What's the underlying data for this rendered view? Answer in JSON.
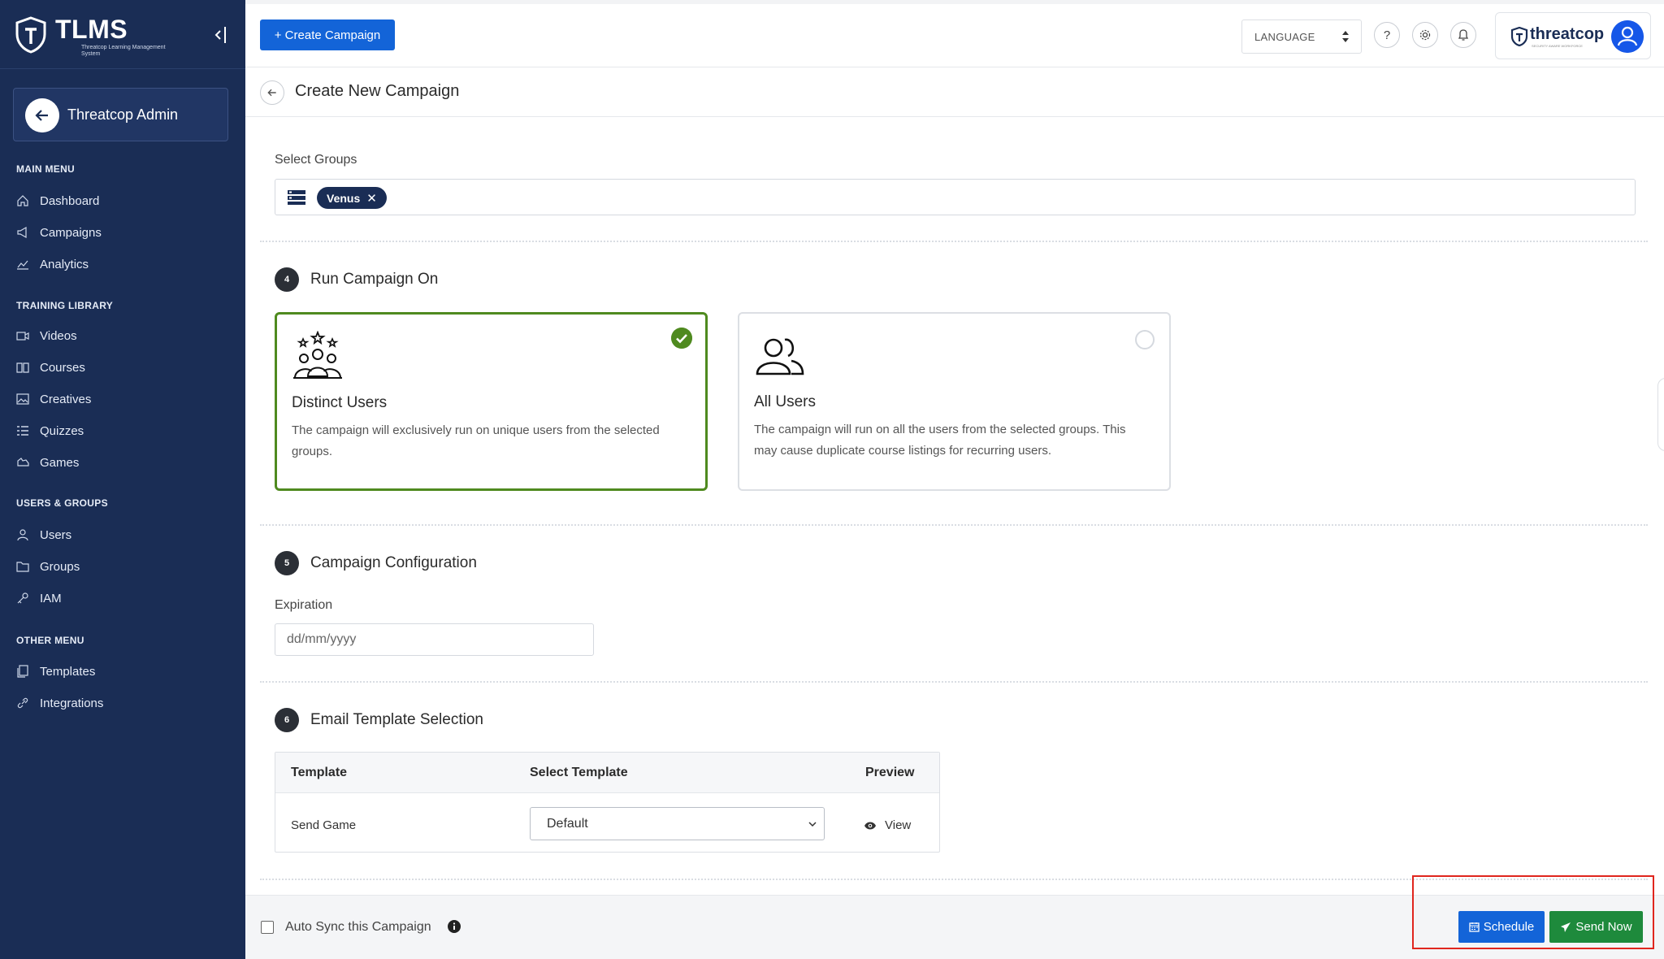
{
  "brand": {
    "name": "TLMS",
    "subtitle": "Threatcop Learning Management System"
  },
  "admin": {
    "name": "Threatcop Admin"
  },
  "sidebar": {
    "sections": [
      {
        "title": "MAIN MENU",
        "items": [
          {
            "label": "Dashboard",
            "icon": "home-icon"
          },
          {
            "label": "Campaigns",
            "icon": "megaphone-icon"
          },
          {
            "label": "Analytics",
            "icon": "chart-line-icon"
          }
        ]
      },
      {
        "title": "TRAINING LIBRARY",
        "items": [
          {
            "label": "Videos",
            "icon": "video-icon"
          },
          {
            "label": "Courses",
            "icon": "book-icon"
          },
          {
            "label": "Creatives",
            "icon": "image-icon"
          },
          {
            "label": "Quizzes",
            "icon": "list-icon"
          },
          {
            "label": "Games",
            "icon": "gamepad-icon"
          }
        ]
      },
      {
        "title": "USERS & GROUPS",
        "items": [
          {
            "label": "Users",
            "icon": "user-icon"
          },
          {
            "label": "Groups",
            "icon": "folder-icon"
          },
          {
            "label": "IAM",
            "icon": "key-icon"
          }
        ]
      },
      {
        "title": "OTHER MENU",
        "items": [
          {
            "label": "Templates",
            "icon": "copy-icon"
          },
          {
            "label": "Integrations",
            "icon": "link-icon"
          }
        ]
      }
    ]
  },
  "topbar": {
    "create_label": "+ Create Campaign",
    "language_label": "LANGUAGE",
    "help_label": "?",
    "company_name": "threatcop",
    "company_tagline": "SECURITY AWARE WORKFORCE"
  },
  "page": {
    "title": "Create New Campaign"
  },
  "groups": {
    "label": "Select Groups",
    "selected": [
      "Venus"
    ]
  },
  "run_campaign": {
    "step": "4",
    "title": "Run Campaign On",
    "options": [
      {
        "title": "Distinct Users",
        "description": "The campaign will exclusively run on unique users from the selected groups.",
        "selected": true
      },
      {
        "title": "All Users",
        "description": "The campaign will run on all the users from the selected groups. This may cause duplicate course listings for recurring users.",
        "selected": false
      }
    ]
  },
  "config": {
    "step": "5",
    "title": "Campaign Configuration",
    "expiration_label": "Expiration",
    "expiration_placeholder": "dd/mm/yyyy"
  },
  "email_template": {
    "step": "6",
    "title": "Email Template Selection",
    "columns": [
      "Template",
      "Select Template",
      "Preview"
    ],
    "rows": [
      {
        "template": "Send Game",
        "selected": "Default",
        "preview": "View"
      }
    ]
  },
  "footer": {
    "auto_sync_label": "Auto Sync this Campaign",
    "auto_sync_checked": false,
    "schedule_label": "Schedule",
    "send_label": "Send Now"
  },
  "colors": {
    "sidebar_bg": "#1a2d55",
    "primary": "#1364d8",
    "success": "#1e8a3c",
    "selected_border": "#4f8a1f",
    "highlight": "#e0261e"
  }
}
